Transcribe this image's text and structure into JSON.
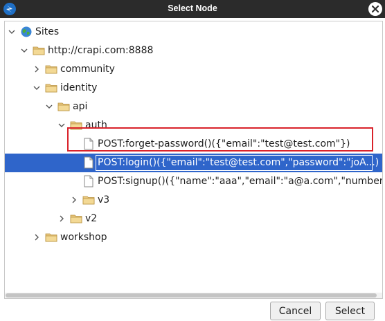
{
  "window": {
    "title": "Select Node",
    "app_icon": "zap-app-icon",
    "close_icon": "close-icon"
  },
  "tree": {
    "nodes": [
      {
        "label": "Sites",
        "icon": "globe-icon",
        "expanded": true
      },
      {
        "label": "http://crapi.com:8888",
        "icon": "folder-icon",
        "expanded": true
      },
      {
        "label": "community",
        "icon": "folder-icon",
        "expanded": false
      },
      {
        "label": "identity",
        "icon": "folder-icon",
        "expanded": true
      },
      {
        "label": "api",
        "icon": "folder-icon",
        "expanded": true
      },
      {
        "label": "auth",
        "icon": "folder-icon",
        "expanded": true
      },
      {
        "label": "POST:forget-password()({\"email\":\"test@test.com\"})",
        "icon": "file-icon"
      },
      {
        "label": "POST:login()({\"email\":\"test@test.com\",\"password\":\"joA...)",
        "icon": "file-icon",
        "selected": true
      },
      {
        "label": "POST:signup()({\"name\":\"aaa\",\"email\":\"a@a.com\",\"number\"...",
        "icon": "file-icon"
      },
      {
        "label": "v3",
        "icon": "folder-icon",
        "expanded": false
      },
      {
        "label": "v2",
        "icon": "folder-icon",
        "expanded": false
      },
      {
        "label": "workshop",
        "icon": "folder-icon",
        "expanded": false
      }
    ]
  },
  "buttons": {
    "cancel_label": "Cancel",
    "select_label": "Select"
  },
  "colors": {
    "titlebar": "#2b2b2b",
    "selection": "#2f65ca",
    "annotation_box": "#d9222a",
    "folder": "#e8c77e"
  }
}
